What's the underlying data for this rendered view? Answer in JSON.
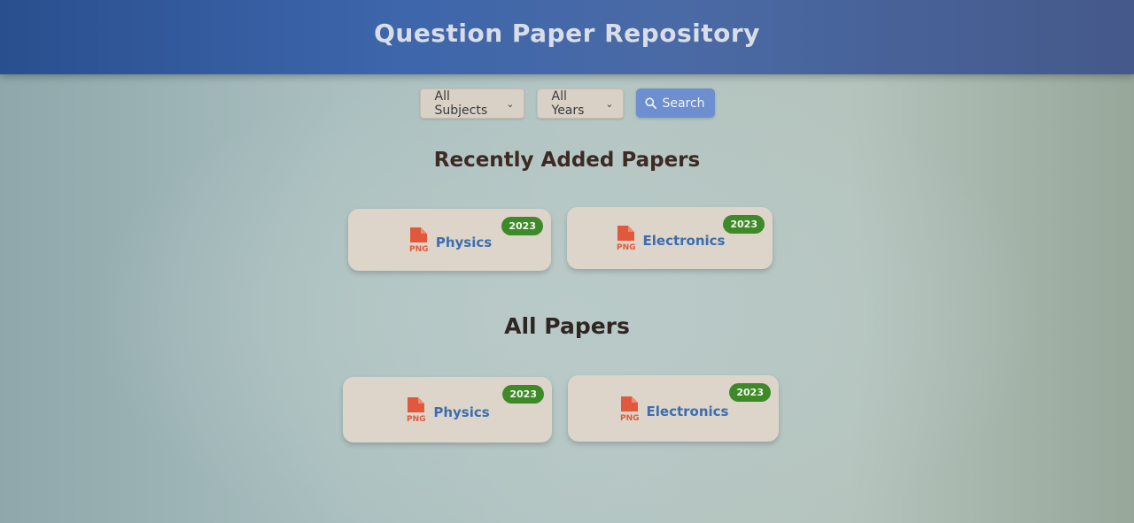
{
  "header": {
    "title": "Question Paper Repository"
  },
  "filters": {
    "subject_select": {
      "value": "All Subjects"
    },
    "year_select": {
      "value": "All Years"
    },
    "search_button": {
      "label": "Search",
      "icon": "search-icon"
    }
  },
  "sections": {
    "recent": {
      "title": "Recently Added Papers",
      "papers": [
        {
          "subject": "Physics",
          "year": "2023",
          "file_type": "PNG",
          "icon": "png-file-icon"
        },
        {
          "subject": "Electronics",
          "year": "2023",
          "file_type": "PNG",
          "icon": "png-file-icon"
        }
      ]
    },
    "all": {
      "title": "All Papers",
      "papers": [
        {
          "subject": "Physics",
          "year": "2023",
          "file_type": "PNG",
          "icon": "png-file-icon"
        },
        {
          "subject": "Electronics",
          "year": "2023",
          "file_type": "PNG",
          "icon": "png-file-icon"
        }
      ]
    }
  },
  "colors": {
    "header_bg": "#3d66ab",
    "accent_button": "#6d8fcf",
    "badge_bg": "#3f8a28",
    "file_icon": "#e0593c",
    "subject_text": "#3c6db0"
  }
}
